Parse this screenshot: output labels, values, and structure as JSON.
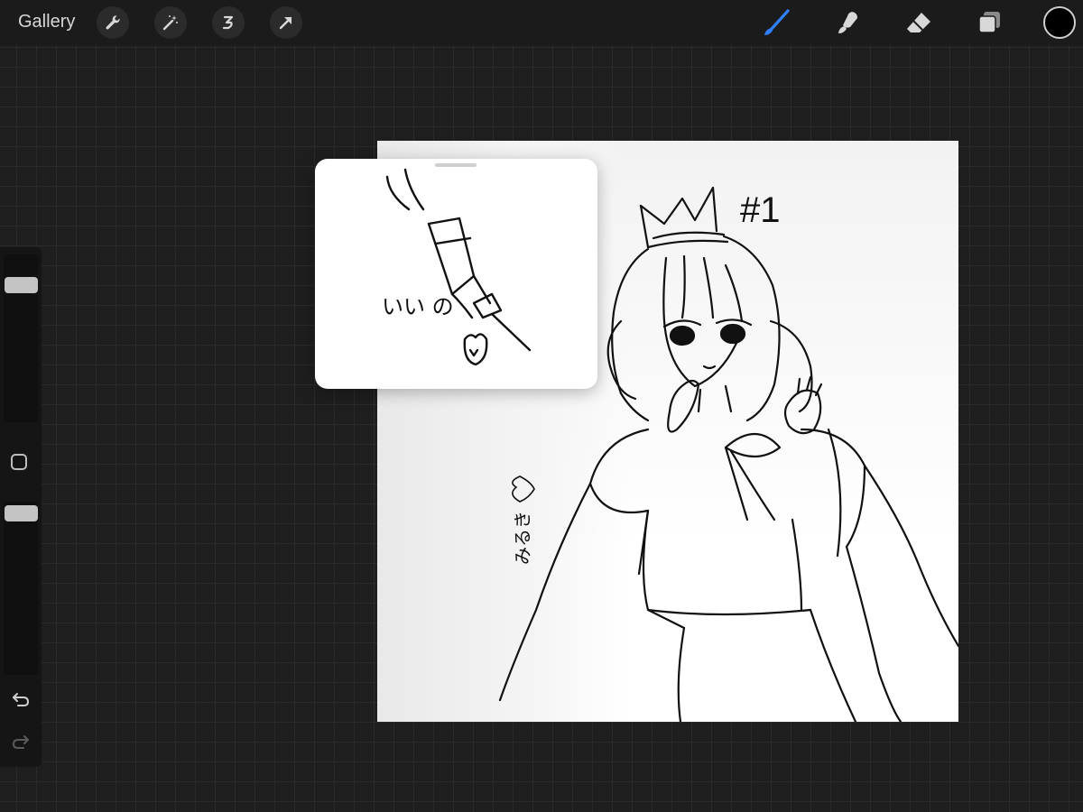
{
  "topbar": {
    "gallery_label": "Gallery",
    "left_tools": [
      "wrench-icon",
      "magic-wand-icon",
      "selection-icon",
      "transform-arrow-icon"
    ],
    "right_tools": [
      "brush-icon",
      "smudge-icon",
      "eraser-icon",
      "layers-icon"
    ],
    "active_tool": "brush-icon",
    "accent_color": "#2f7fff",
    "current_color": "#000000"
  },
  "sidebar": {
    "size_slider_value": 0.03,
    "opacity_slider_value": 0.03
  },
  "reference": {
    "text": "いい の"
  },
  "canvas": {
    "annotation_number": "#1",
    "signature": "みるき"
  }
}
